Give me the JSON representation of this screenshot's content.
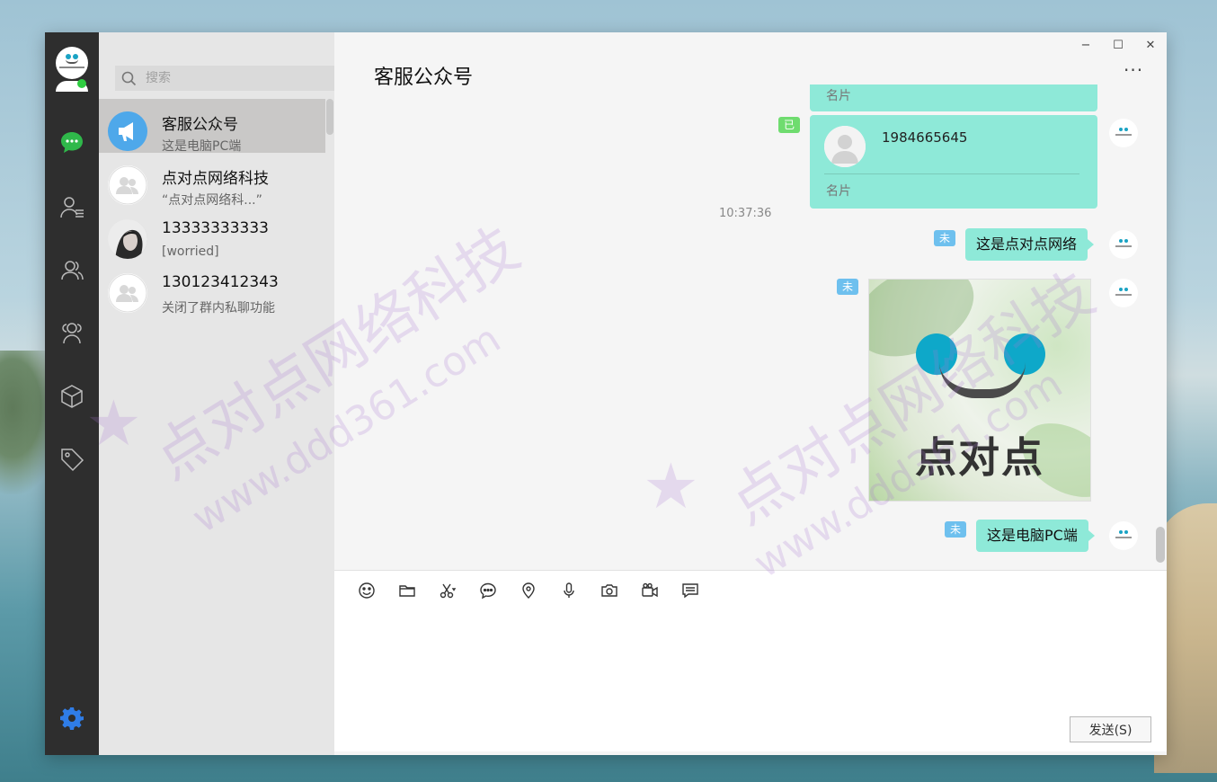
{
  "search": {
    "placeholder": "搜索"
  },
  "sessions": [
    {
      "name": "客服公众号",
      "preview": "这是电脑PC端"
    },
    {
      "name": "点对点网络科技",
      "preview": "“点对点网络科...”"
    },
    {
      "name": "13333333333",
      "preview": "[worried]"
    },
    {
      "name": "130123412343",
      "preview": "关闭了群内私聊功能"
    }
  ],
  "chat": {
    "title": "客服公众号",
    "more": "···",
    "card_top": {
      "label": "名片"
    },
    "card_main": {
      "number": "1984665645",
      "label": "名片",
      "status": "已"
    },
    "time": "10:37:36",
    "msg1": {
      "text": "这是点对点网络",
      "status": "未"
    },
    "msg_image": {
      "status": "未",
      "brand_text": "点对点"
    },
    "msg2": {
      "text": "这是电脑PC端",
      "status": "未"
    }
  },
  "window_controls": {
    "minimize": "−",
    "maximize": "☐",
    "close": "✕"
  },
  "input": {
    "send_label": "发送(S)"
  },
  "watermark": {
    "text1": "点对点网络科技",
    "text2": "www.ddd361.com",
    "text3": "点对点网络科技",
    "text4": "www.ddd361.com"
  },
  "colors": {
    "bubble": "#8ee9d8",
    "unread_tag": "#6ec0ee",
    "read_tag": "#6fdc6f",
    "rail": "#2e2e2e",
    "accent_green": "#2ecc40",
    "settings_blue": "#2f7de8"
  }
}
